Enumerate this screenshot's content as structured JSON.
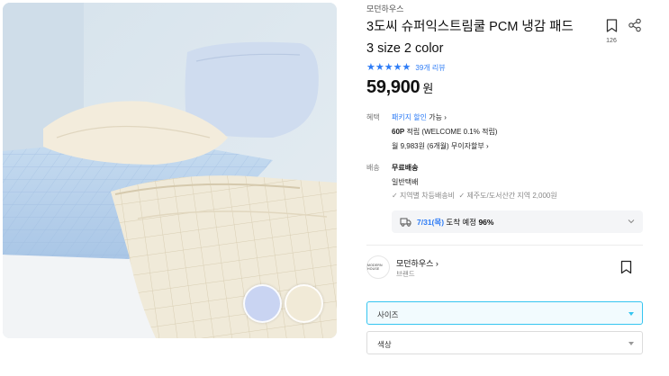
{
  "product": {
    "brand_small": "모던하우스",
    "title": "3도씨 슈퍼익스트림쿨 PCM 냉감 패드 3 size 2 color",
    "bookmark_count": "126",
    "rating_stars": 5,
    "review_text": "39개 리뷰",
    "price": "59,900",
    "currency": "원",
    "swatches": [
      {
        "name": "blue",
        "color": "#c9d4f2"
      },
      {
        "name": "beige",
        "color": "#f1ead7"
      }
    ]
  },
  "benefits": {
    "label": "혜택",
    "package_link": "패키지 할인",
    "package_suffix": "가능",
    "points_bold": "60P",
    "points_rest": "적립 (WELCOME 0.1% 적립)",
    "installment": "월 9,983원 (6개월) 무이자할부"
  },
  "shipping": {
    "label": "배송",
    "fee": "무료배송",
    "type": "일반택배",
    "check1": "지역별 차등배송비",
    "check2": "제주도/도서산간 지역 2,000원",
    "arrival_date": "7/31(목)",
    "arrival_text": "도착 예정",
    "arrival_pct": "96%"
  },
  "store": {
    "logo_text": "MODERN HOUSE",
    "name": "모던하우스",
    "sub": "브랜드"
  },
  "options": {
    "size_label": "사이즈",
    "color_label": "색상"
  },
  "colors": {
    "accent": "#2e7cf6",
    "select_active": "#35c5f0"
  }
}
